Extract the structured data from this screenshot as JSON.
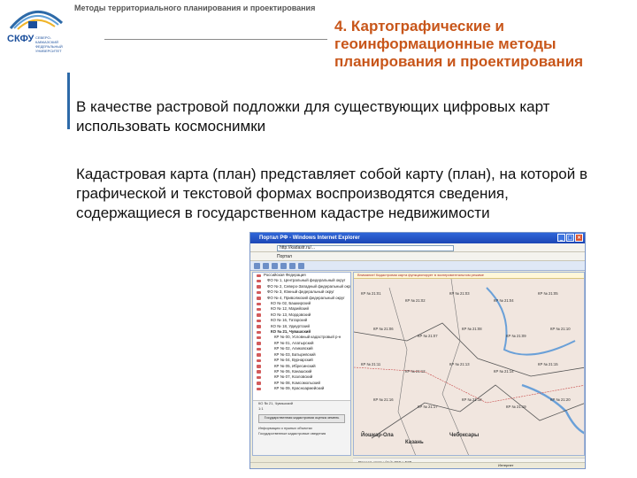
{
  "header": {
    "title": "Методы территориального планирования и проектирования",
    "logo_text": "СКФУ",
    "logo_sub": "СЕВЕРО-КАВКАЗСКИЙ ФЕДЕРАЛЬНЫЙ УНИВЕРСИТЕТ",
    "section_title": "4. Картографические и геоинформационные методы планирования и проектирования"
  },
  "body": {
    "paragraph1": "В качестве растровой подложки для существующих цифровых карт использовать космоснимки",
    "paragraph2": "Кадастровая карта (план) представляет собой карту (план), на которой в графической и текстовой формах воспроизводятся сведения, содержащиеся в государственном кадастре недвижимости"
  },
  "screenshot": {
    "window_title": "Портал РФ - Windows Internet Explorer",
    "address": "http://kadastr.ru/...",
    "tab_label": "Портал",
    "map_warning": "Внимание! Кадастровая карта функционирует в экспериментальном режиме",
    "tree_items": [
      "Российская Федерация",
      "ФО № 1, Центральный федеральный округ",
      "ФО № 2, Северо-Западный федеральный округ",
      "ФО № 3, Южный федеральный округ",
      "ФО № 4, Приволжский федеральный округ",
      "КО № 02, Башкирский",
      "КО № 12, Марийский",
      "КО № 13, Мордовский",
      "КО № 16, Татарский",
      "КО № 18, Удмуртский",
      "КО № 21, Чувашский",
      "КР № 00, Условный кадастровый р-н",
      "КР № 01, Алатырский",
      "КР № 02, Аликовский",
      "КР № 03, Батыревский",
      "КР № 04, Вурнарский",
      "КР № 05, Ибресинский",
      "КР № 06, Канашский",
      "КР № 07, Козловский",
      "КР № 08, Комсомольский",
      "КР № 09, Красноармейский"
    ],
    "selected_index": 10,
    "pane_footer": {
      "breadcrumb": "КО № 21, Чувашский",
      "scale": "1:1",
      "button_label": "Государственная кадастровая оценка земель",
      "line1": "Информация о нужных объектах",
      "line2": "Государственные кадастровые сведения"
    },
    "map_footer": "Размер карты (px): 860 x 520",
    "status": "Интернет",
    "map_labels": [
      "КР № 21:01",
      "КР № 21:02",
      "КР № 21:03",
      "КР № 21:04",
      "КР № 21:05",
      "КР № 21:06",
      "КР № 21:07",
      "КР № 21:08",
      "КР № 21:09",
      "КР № 21:10",
      "КР № 21:11",
      "КР № 21:12",
      "КР № 21:13",
      "КР № 21:14",
      "КР № 21:15",
      "КР № 21:16",
      "КР № 21:17",
      "КР № 21:18",
      "КР № 21:19",
      "КР № 21:20",
      "Йошкар-Ола",
      "Казань",
      "Чебоксары"
    ]
  },
  "colors": {
    "accent": "#c8561a",
    "logo_blue": "#1b4f9c",
    "title_bar": "#2f66d8",
    "tree_icon": "#d25b5b"
  }
}
